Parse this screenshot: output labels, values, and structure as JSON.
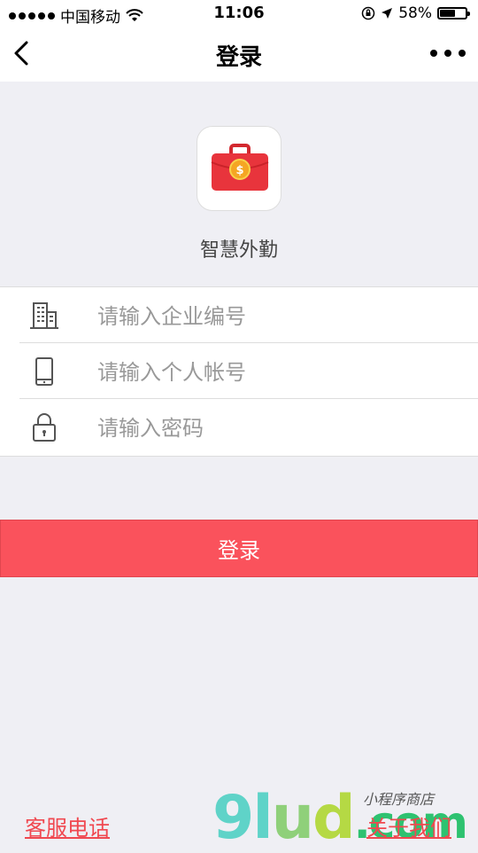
{
  "status_bar": {
    "carrier": "中国移动",
    "time": "11:06",
    "battery": "58%",
    "battery_level": 0.58
  },
  "nav": {
    "title": "登录",
    "back_icon": "chevron-left-icon",
    "more_icon": "more-horizontal-icon"
  },
  "app": {
    "name": "智慧外勤",
    "icon": "briefcase-icon",
    "accent": "#e8343c"
  },
  "form": {
    "company": {
      "placeholder": "请输入企业编号",
      "value": "",
      "icon": "building-icon"
    },
    "account": {
      "placeholder": "请输入个人帐号",
      "value": "",
      "icon": "phone-icon"
    },
    "password": {
      "placeholder": "请输入密码",
      "value": "",
      "icon": "lock-icon"
    }
  },
  "login_button": {
    "label": "登录",
    "color": "#fa525c"
  },
  "footer": {
    "left_link": "客服电话",
    "right_link": "关于我们"
  },
  "watermark": {
    "brand": "9lud",
    "domain": ".com",
    "tagline": "小程序商店"
  }
}
